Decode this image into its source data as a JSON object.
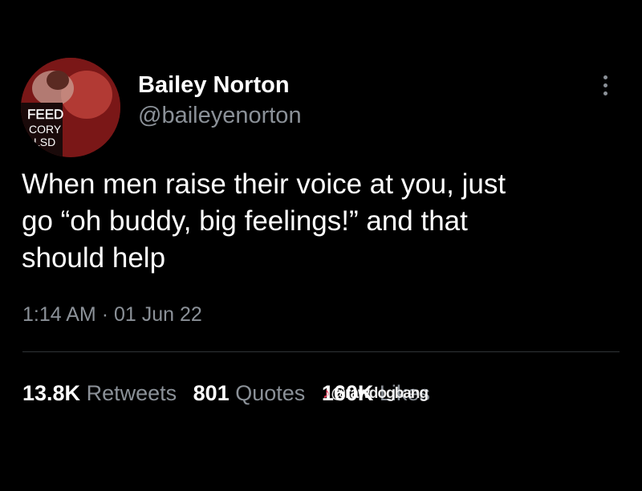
{
  "tweet": {
    "author": {
      "display_name": "Bailey Norton",
      "handle": "@baileyenorton",
      "avatar_text": [
        "FEED",
        "CORY",
        "LSD"
      ]
    },
    "more_icon": "more-horizontal-icon",
    "text_lines": [
      "When men raise their voice at you, just",
      "go “oh buddy, big feelings!” and that",
      "should help"
    ],
    "time": "1:14 AM",
    "separator": "·",
    "date": "01 Jun 22",
    "stats": {
      "retweets_count": "13.8K",
      "retweets_label": "Retweets",
      "quotes_count": "801",
      "quotes_label": "Quotes",
      "likes_count": "160K",
      "likes_label": "Likes"
    }
  },
  "watermark": {
    "icon": "tiktok-note-icon",
    "text": "@rawdogbang"
  },
  "colors": {
    "background": "#000000",
    "primary_text": "#ffffff",
    "secondary_text": "#8b9198",
    "divider": "#2f3336"
  }
}
